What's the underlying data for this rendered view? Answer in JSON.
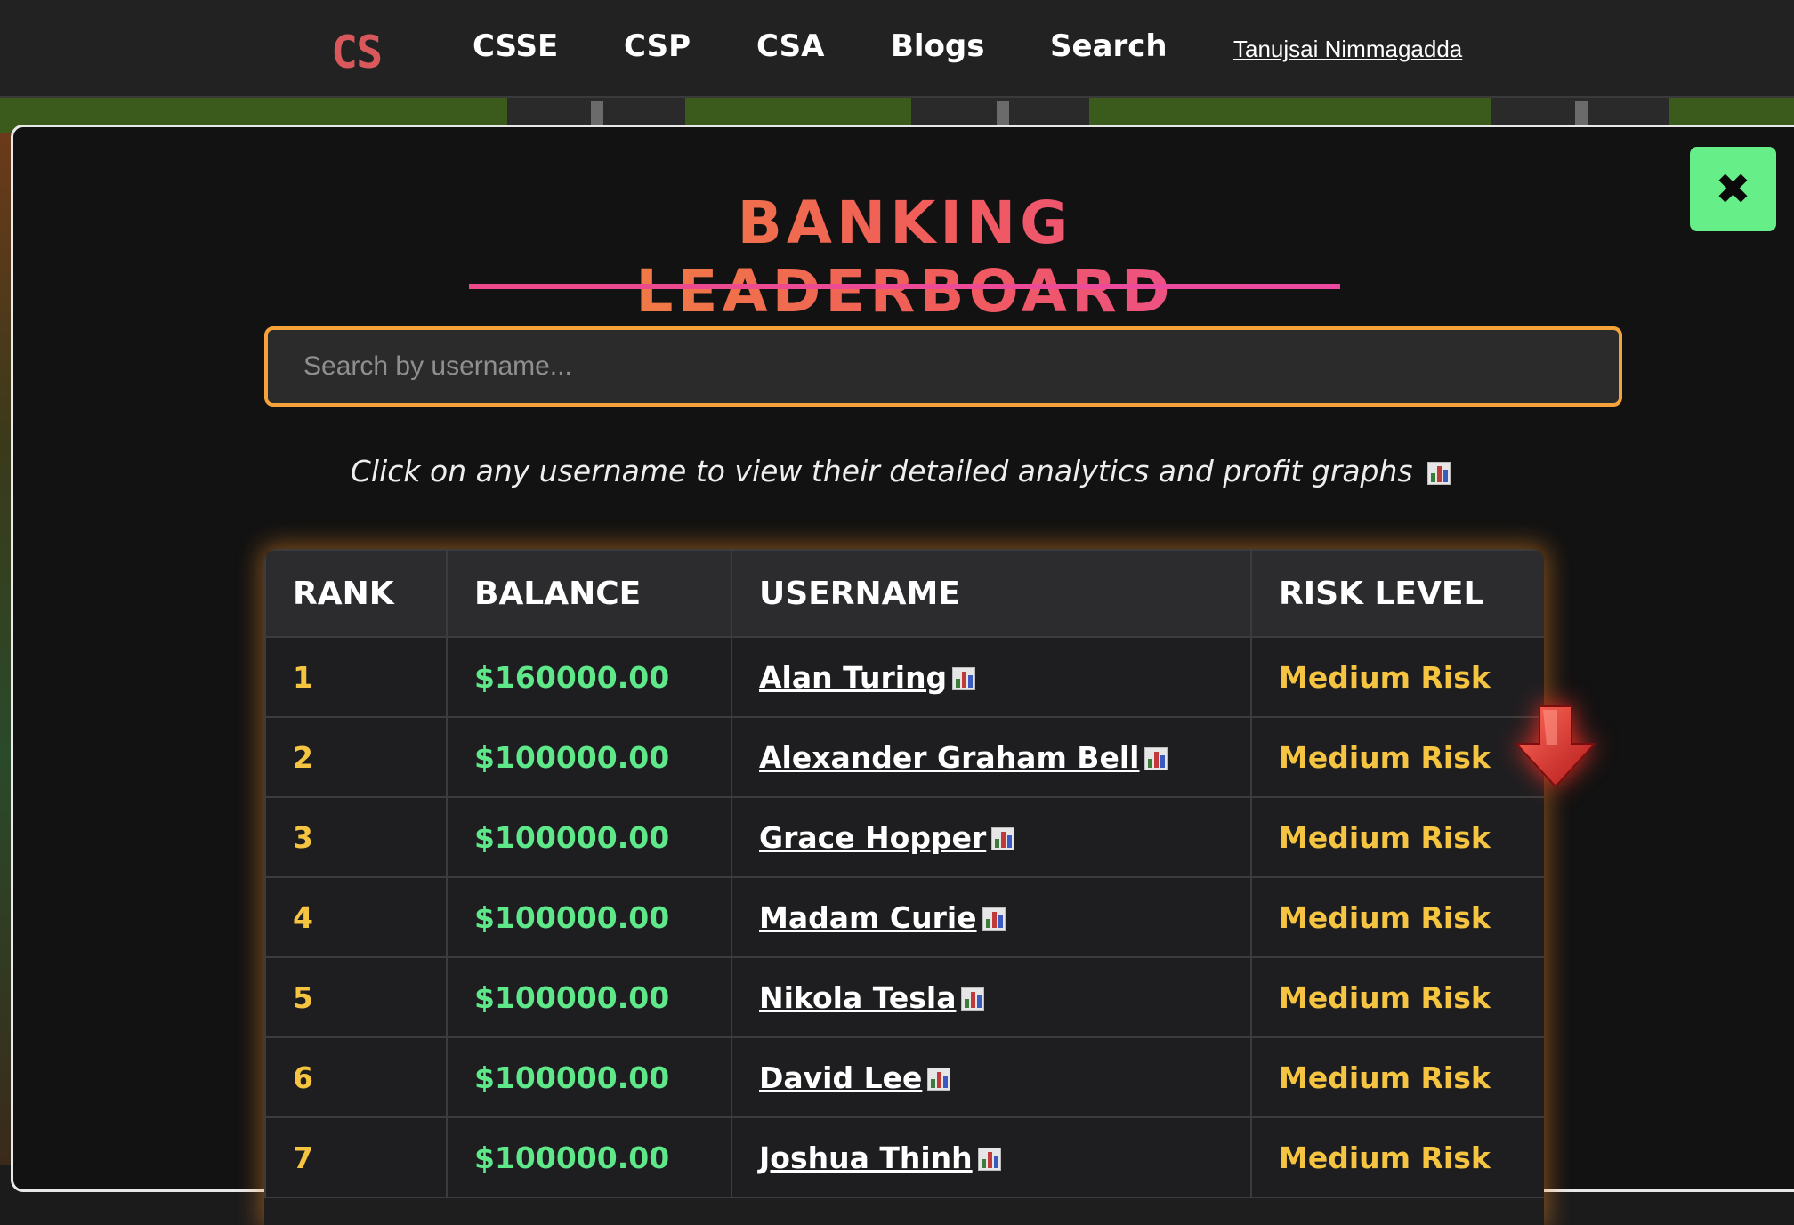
{
  "nav": {
    "logo": "CS",
    "links": [
      "CSSE",
      "CSP",
      "CSA",
      "Blogs",
      "Search"
    ],
    "user": "Tanujsai Nimmagadda"
  },
  "modal": {
    "close_label": "✖",
    "title": "BANKING LEADERBOARD",
    "search_placeholder": "Search by username...",
    "hint": "Click on any username to view their detailed analytics and profit graphs",
    "table": {
      "headers": [
        "RANK",
        "BALANCE",
        "USERNAME",
        "RISK LEVEL"
      ],
      "rows": [
        {
          "rank": "1",
          "balance": "$160000.00",
          "username": "Alan Turing",
          "risk": "Medium Risk"
        },
        {
          "rank": "2",
          "balance": "$100000.00",
          "username": "Alexander Graham Bell",
          "risk": "Medium Risk"
        },
        {
          "rank": "3",
          "balance": "$100000.00",
          "username": "Grace Hopper",
          "risk": "Medium Risk"
        },
        {
          "rank": "4",
          "balance": "$100000.00",
          "username": "Madam Curie",
          "risk": "Medium Risk"
        },
        {
          "rank": "5",
          "balance": "$100000.00",
          "username": "Nikola Tesla",
          "risk": "Medium Risk"
        },
        {
          "rank": "6",
          "balance": "$100000.00",
          "username": "David Lee",
          "risk": "Medium Risk"
        },
        {
          "rank": "7",
          "balance": "$100000.00",
          "username": "Joshua Thinh",
          "risk": "Medium Risk"
        }
      ]
    }
  },
  "colors": {
    "accent_orange": "#f5a23a",
    "balance_green": "#5fe88a",
    "rank_yellow": "#f5c542",
    "close_green": "#66ef88"
  },
  "icons": {
    "chart": "bar-chart-icon",
    "scroll": "red-down-arrow-icon"
  }
}
